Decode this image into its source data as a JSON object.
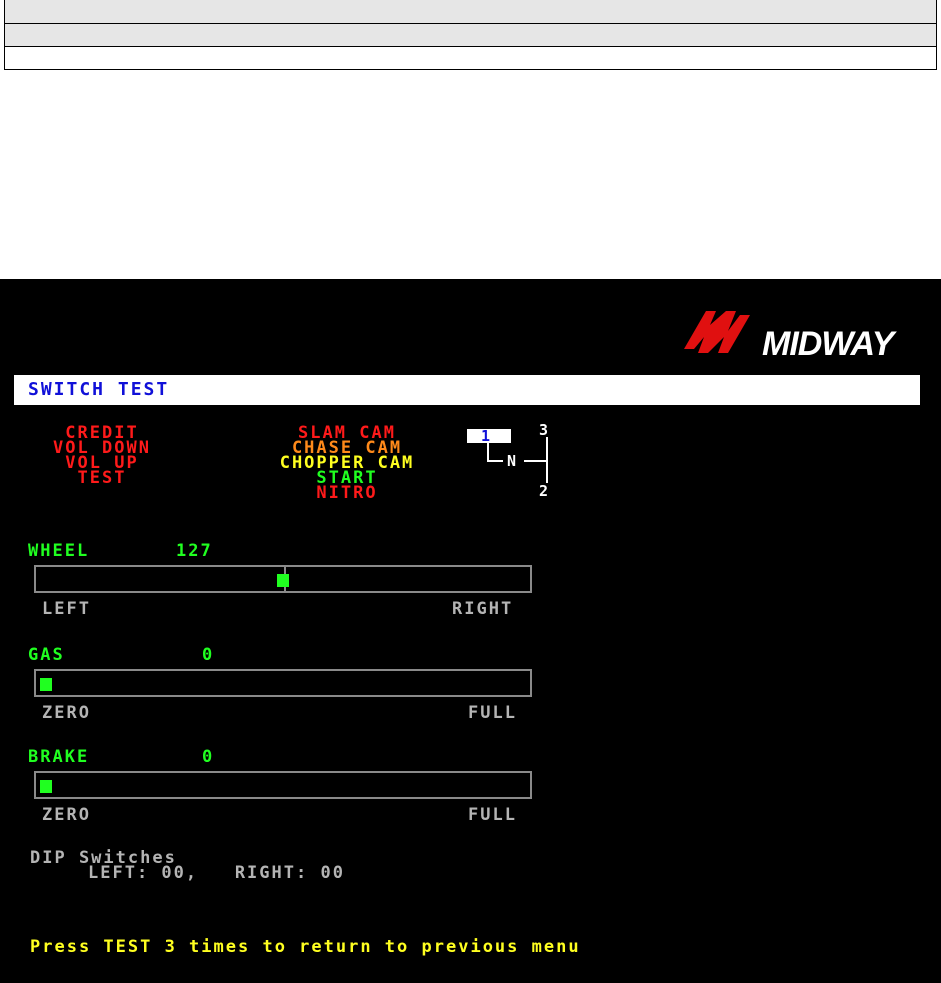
{
  "header": {
    "logo_text": "MIDWAY",
    "title": "SWITCH TEST"
  },
  "switches": {
    "left": [
      "CREDIT",
      "VOL DOWN",
      "VOL UP",
      "TEST"
    ],
    "right": [
      "SLAM CAM",
      "CHASE CAM",
      "CHOPPER CAM",
      "START",
      "NITRO"
    ]
  },
  "gearbox": {
    "selected": "1",
    "gear_3": "3",
    "neutral": "N",
    "gear_2": "2"
  },
  "wheel": {
    "label": "WHEEL",
    "value": "127",
    "left_label": "LEFT",
    "right_label": "RIGHT",
    "level": 0.5
  },
  "gas": {
    "label": "GAS",
    "value": "0",
    "left_label": "ZERO",
    "right_label": "FULL",
    "level": 0
  },
  "brake": {
    "label": "BRAKE",
    "value": "0",
    "left_label": "ZERO",
    "right_label": "FULL",
    "level": 0
  },
  "dip": {
    "title": "DIP Switches",
    "values": "LEFT: 00,   RIGHT: 00"
  },
  "footer": {
    "text": "Press TEST 3 times to return to previous menu"
  },
  "colors": {
    "red": "#ff1a1a",
    "orange": "#ff8a1a",
    "yellow": "#ffff20",
    "green": "#20ff20",
    "grey": "#b4b4b4",
    "title_blue": "#1010d8"
  }
}
